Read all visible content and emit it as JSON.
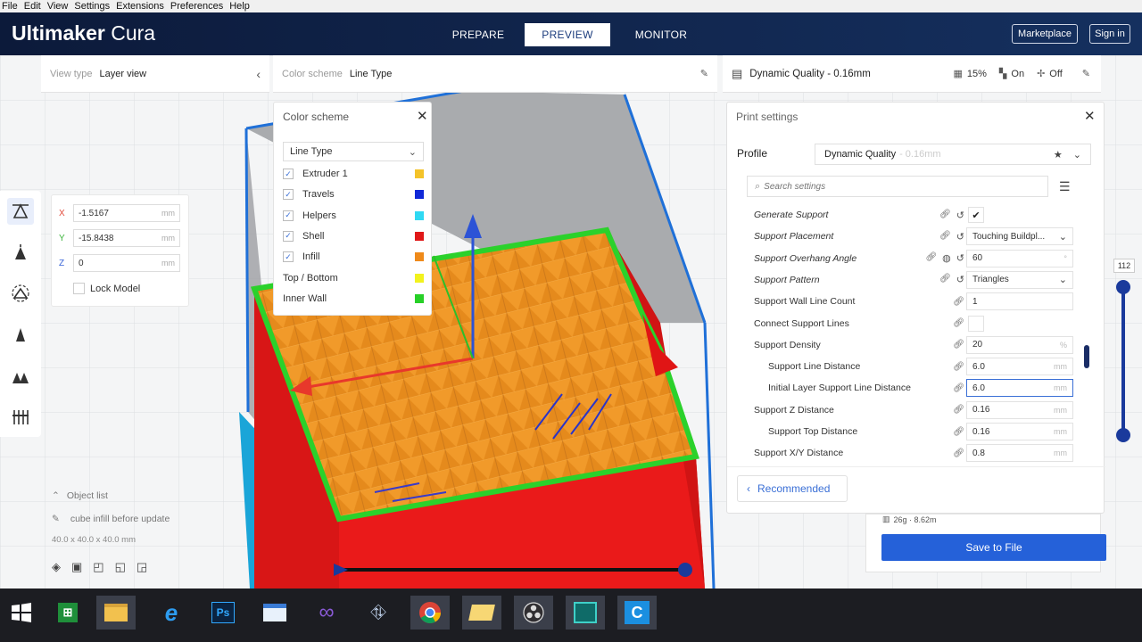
{
  "menu": [
    "File",
    "Edit",
    "View",
    "Settings",
    "Extensions",
    "Preferences",
    "Help"
  ],
  "app": {
    "brand_bold": "Ultimaker",
    "brand_light": "Cura"
  },
  "stages": {
    "prepare": "PREPARE",
    "preview": "PREVIEW",
    "monitor": "MONITOR"
  },
  "header_buttons": {
    "marketplace": "Marketplace",
    "signin": "Sign in"
  },
  "viewtype": {
    "label": "View type",
    "value": "Layer view"
  },
  "colorbar": {
    "label": "Color scheme",
    "value": "Line Type"
  },
  "printsummary": {
    "profile": "Dynamic Quality - 0.16mm",
    "infill": "15%",
    "support": "On",
    "adhesion": "Off"
  },
  "coords": {
    "x": {
      "axis": "X",
      "value": "-1.5167",
      "unit": "mm"
    },
    "y": {
      "axis": "Y",
      "value": "-15.8438",
      "unit": "mm"
    },
    "z": {
      "axis": "Z",
      "value": "0",
      "unit": "mm"
    },
    "lock": "Lock Model"
  },
  "colorscheme": {
    "title": "Color scheme",
    "dropdown": "Line Type",
    "items": [
      {
        "label": "Extruder 1",
        "color": "#f4c329",
        "checked": true
      },
      {
        "label": "Travels",
        "color": "#1028d8",
        "checked": true
      },
      {
        "label": "Helpers",
        "color": "#2fd9f3",
        "checked": true
      },
      {
        "label": "Shell",
        "color": "#e01818",
        "checked": true
      },
      {
        "label": "Infill",
        "color": "#ef8a1a",
        "checked": true
      },
      {
        "label": "Top / Bottom",
        "color": "#f2f21e",
        "checked": false
      },
      {
        "label": "Inner Wall",
        "color": "#27d027",
        "checked": false
      }
    ]
  },
  "printsettings": {
    "title": "Print settings",
    "profile_label": "Profile",
    "profile_value": "Dynamic Quality",
    "profile_suffix": "- 0.16mm",
    "search_placeholder": "Search settings",
    "recommended": "Recommended",
    "rows": [
      {
        "label": "Generate Support",
        "value": "✔",
        "unit": "",
        "style": "italic"
      },
      {
        "label": "Support Placement",
        "value": "Touching Buildpl...",
        "unit": "",
        "style": "italic"
      },
      {
        "label": "Support Overhang Angle",
        "value": "60",
        "unit": "°",
        "style": "italic"
      },
      {
        "label": "Support Pattern",
        "value": "Triangles",
        "unit": "",
        "style": "italic"
      },
      {
        "label": "Support Wall Line Count",
        "value": "1",
        "unit": "",
        "style": "normal"
      },
      {
        "label": "Connect Support Lines",
        "value": "",
        "unit": "",
        "style": "normal"
      },
      {
        "label": "Support Density",
        "value": "20",
        "unit": "%",
        "style": "normal"
      },
      {
        "label": "Support Line Distance",
        "value": "6.0",
        "unit": "mm",
        "style": "indent"
      },
      {
        "label": "Initial Layer Support Line Distance",
        "value": "6.0",
        "unit": "mm",
        "style": "indent"
      },
      {
        "label": "Support Z Distance",
        "value": "0.16",
        "unit": "mm",
        "style": "normal"
      },
      {
        "label": "Support Top Distance",
        "value": "0.16",
        "unit": "mm",
        "style": "indent"
      },
      {
        "label": "Support X/Y Distance",
        "value": "0.8",
        "unit": "mm",
        "style": "normal"
      }
    ]
  },
  "objectlist": {
    "title": "Object list",
    "name": "cube infill before update",
    "dims": "40.0 x 40.0 x 40.0 mm"
  },
  "layer_slider": {
    "max_label": "112"
  },
  "save": {
    "estimate": "26g · 8.62m",
    "button": "Save to File"
  },
  "taskbar_icons": [
    "windows-start-icon",
    "excel-icon",
    "file-explorer-icon",
    "internet-explorer-icon",
    "photoshop-icon",
    "window-icon",
    "visual-studio-icon",
    "network-icon",
    "chrome-icon",
    "folder-icon",
    "obs-icon",
    "video-editor-icon",
    "cura-icon"
  ]
}
